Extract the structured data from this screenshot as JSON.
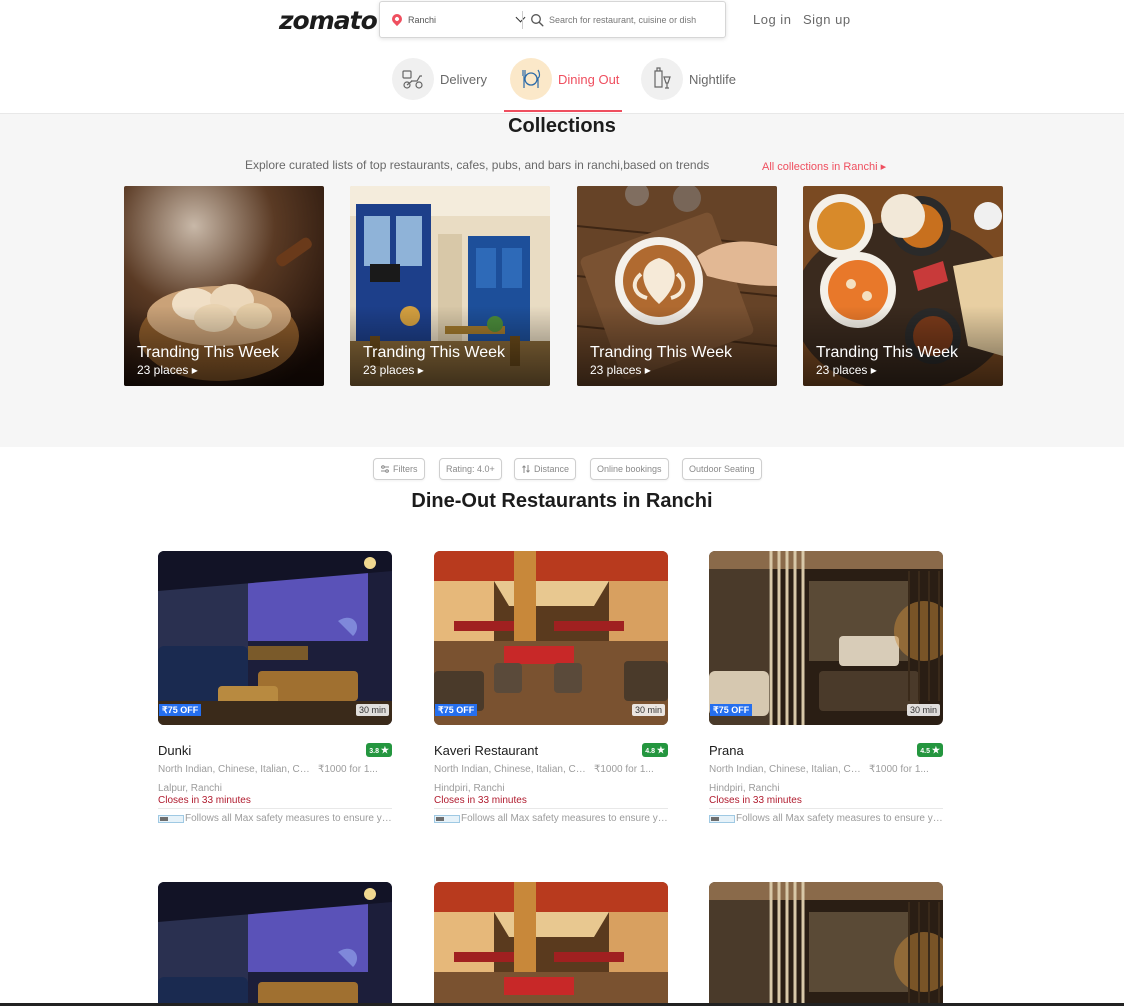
{
  "header": {
    "logo": "zomato",
    "location": "Ranchi",
    "search_placeholder": "Search for restaurant, cuisine or dish",
    "login": "Log in",
    "signup": "Sign up"
  },
  "tabs": [
    {
      "label": "Delivery",
      "icon": "delivery-icon",
      "active": false
    },
    {
      "label": "Dining Out",
      "icon": "dining-out-icon",
      "active": true
    },
    {
      "label": "Nightlife",
      "icon": "nightlife-icon",
      "active": false
    }
  ],
  "collections": {
    "title": "Collections",
    "subtitle": "Explore curated lists of top restaurants, cafes, pubs, and bars in ranchi,based on trends",
    "all_link": "All collections in Ranchi",
    "cards": [
      {
        "name": "Tranding This Week",
        "places": "23 places"
      },
      {
        "name": "Tranding This Week",
        "places": "23 places"
      },
      {
        "name": "Tranding This Week",
        "places": "23 places"
      },
      {
        "name": "Tranding This Week",
        "places": "23 places"
      }
    ]
  },
  "filters": [
    "Filters",
    "Rating: 4.0+",
    "Distance",
    "Online bookings",
    "Outdoor Seating"
  ],
  "section_title": "Dine-Out Restaurants in Ranchi",
  "restaurants": [
    {
      "name": "Dunki",
      "rating": "3.8",
      "offer": "₹75 OFF",
      "eta": "30 min",
      "cuisine": "North Indian, Chinese, Italian, Continental",
      "cost": "₹1000 for 1...",
      "location": "Lalpur, Ranchi",
      "closes": "Closes in 33 minutes",
      "safety": "Follows all Max safety measures to ensure your food is safe"
    },
    {
      "name": "Kaveri Restaurant",
      "rating": "4.8",
      "offer": "₹75 OFF",
      "eta": "30 min",
      "cuisine": "North Indian, Chinese, Italian, Continental",
      "cost": "₹1000 for 1...",
      "location": "Hindpiri, Ranchi",
      "closes": "Closes in 33 minutes",
      "safety": "Follows all Max safety measures to ensure your food is safe"
    },
    {
      "name": "Prana",
      "rating": "4.5",
      "offer": "₹75 OFF",
      "eta": "30 min",
      "cuisine": "North Indian, Chinese, Italian, Continental",
      "cost": "₹1000 for 1...",
      "location": "Hindpiri, Ranchi",
      "closes": "Closes in 33 minutes",
      "safety": "Follows all Max safety measures to ensure your food is safe"
    }
  ],
  "colors": {
    "brand": "#ef4f5f",
    "rating": "#24963f",
    "offer": "#256fef",
    "closes": "#b01b2e",
    "background": "#f6f6f6"
  }
}
